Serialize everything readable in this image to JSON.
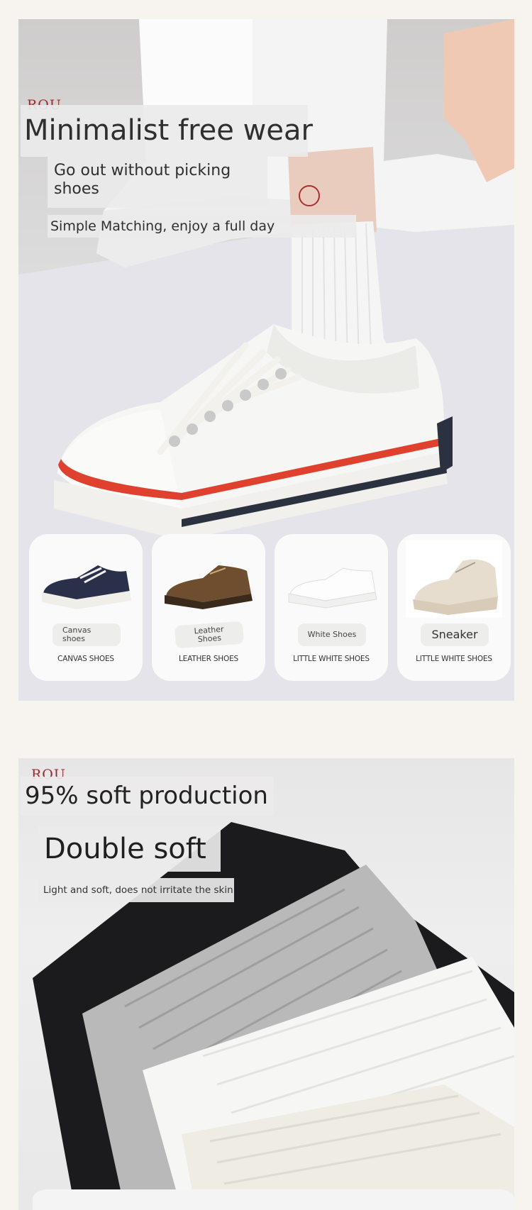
{
  "hero": {
    "brand": "ROU",
    "headline": "Minimalist free wear",
    "subline_1": "Go out without picking",
    "subline_2": "shoes",
    "tagline": "Simple Matching, enjoy a full day",
    "cards": [
      {
        "pill": "Canvas\nshoes",
        "caption": "CANVAS SHOES"
      },
      {
        "pill": "Leather\nShoes",
        "caption": "LEATHER SHOES"
      },
      {
        "pill": "White Shoes",
        "caption": "LITTLE WHITE SHOES"
      },
      {
        "pill": "Sneaker",
        "caption": "LITTLE WHITE SHOES"
      }
    ]
  },
  "socks": {
    "brand": "ROU",
    "headline": "95% soft production",
    "title": "Double soft",
    "description": "Light and soft, does not irritate the skin"
  },
  "colors": {
    "page_bg": "#f7f4f0",
    "sole_stripe_red": "#e0412e",
    "sole_stripe_navy": "#2c3140",
    "brand_red": "#9a2a2a"
  }
}
